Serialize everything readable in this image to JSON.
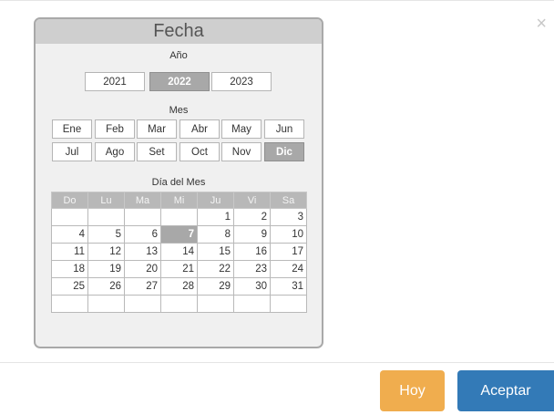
{
  "dialog": {
    "close_label": "×",
    "buttons": {
      "hoy": "Hoy",
      "aceptar": "Aceptar"
    }
  },
  "picker": {
    "title": "Fecha",
    "year_label": "Año",
    "years": [
      "2021",
      "2022",
      "2023"
    ],
    "selected_year": "2022",
    "month_label": "Mes",
    "months": [
      "Ene",
      "Feb",
      "Mar",
      "Abr",
      "May",
      "Jun",
      "Jul",
      "Ago",
      "Set",
      "Oct",
      "Nov",
      "Dic"
    ],
    "selected_month": "Dic",
    "day_label": "Día del Mes",
    "weekdays": [
      "Do",
      "Lu",
      "Ma",
      "Mi",
      "Ju",
      "Vi",
      "Sa"
    ],
    "weeks": [
      [
        "",
        "",
        "",
        "",
        "1",
        "2",
        "3"
      ],
      [
        "4",
        "5",
        "6",
        "7",
        "8",
        "9",
        "10"
      ],
      [
        "11",
        "12",
        "13",
        "14",
        "15",
        "16",
        "17"
      ],
      [
        "18",
        "19",
        "20",
        "21",
        "22",
        "23",
        "24"
      ],
      [
        "25",
        "26",
        "27",
        "28",
        "29",
        "30",
        "31"
      ],
      [
        "",
        "",
        "",
        "",
        "",
        "",
        ""
      ]
    ],
    "selected_day": "7"
  },
  "colors": {
    "hoy": "#f0ad4e",
    "aceptar": "#337ab7",
    "selected": "#a8a8a8"
  }
}
